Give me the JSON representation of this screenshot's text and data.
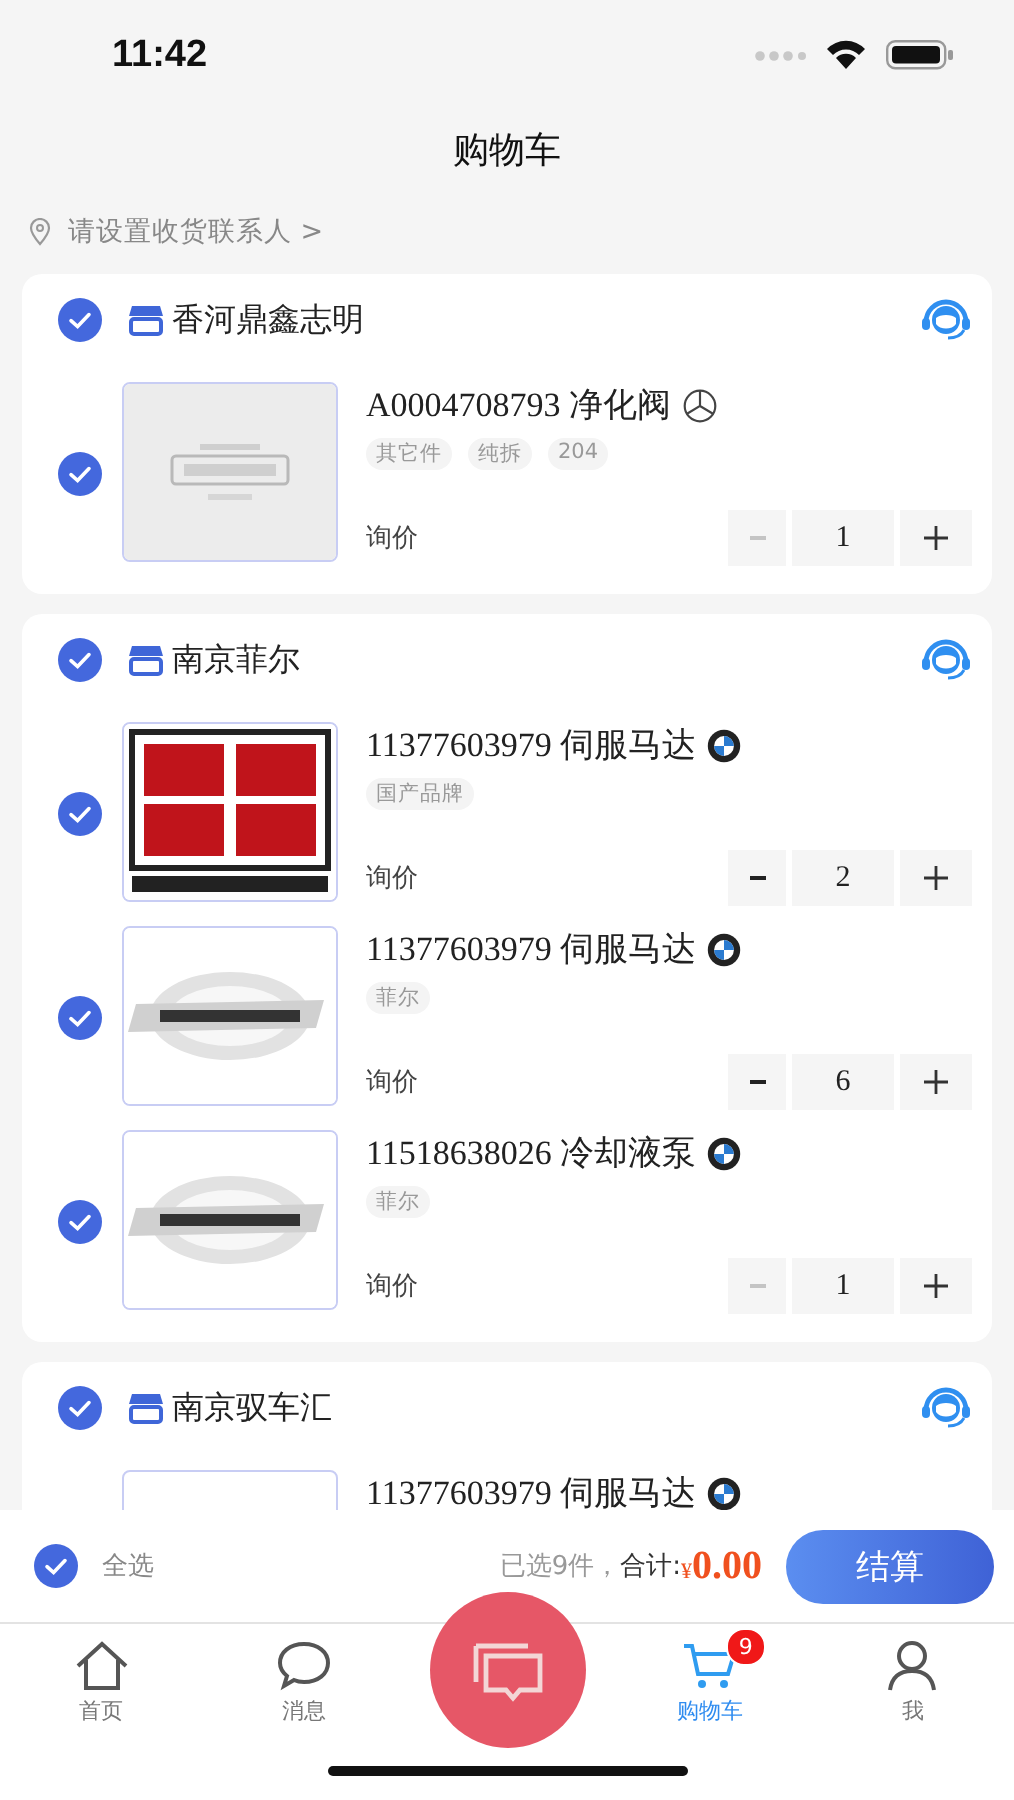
{
  "status_bar": {
    "time": "11:42"
  },
  "title": "购物车",
  "address": {
    "text": "请设置收货联系人 >"
  },
  "shops": [
    {
      "name": "香河鼎鑫志明",
      "checked": true,
      "items": [
        {
          "checked": true,
          "title": "A0004708793 净化阀",
          "tags": [
            "其它件",
            "纯拆",
            "204"
          ],
          "price": "询价",
          "quantity": "1",
          "minus_disabled": true
        }
      ]
    },
    {
      "name": "南京菲尔",
      "checked": true,
      "items": [
        {
          "checked": true,
          "title": "11377603979 伺服马达",
          "tags": [
            "国产品牌"
          ],
          "price": "询价",
          "quantity": "2",
          "minus_disabled": false
        },
        {
          "checked": true,
          "title": "11377603979 伺服马达",
          "tags": [
            "菲尔"
          ],
          "price": "询价",
          "quantity": "6",
          "minus_disabled": false
        },
        {
          "checked": true,
          "title": "11518638026 冷却液泵",
          "tags": [
            "菲尔"
          ],
          "price": "询价",
          "quantity": "1",
          "minus_disabled": true
        }
      ]
    },
    {
      "name": "南京驭车汇",
      "checked": true,
      "items": [
        {
          "title": "11377603979 伺服马达"
        }
      ]
    }
  ],
  "footer": {
    "select_all": {
      "label": "全选",
      "checked": true
    },
    "summary": "已选9件，",
    "total_label": "合计:",
    "currency": "¥",
    "total": "0.00",
    "checkout": "结算"
  },
  "tabs": [
    {
      "kind": "home",
      "label": "首页",
      "selected": false
    },
    {
      "kind": "message",
      "label": "消息",
      "selected": false
    },
    {
      "kind": "fab"
    },
    {
      "kind": "cart",
      "label": "购物车",
      "selected": true,
      "badge": "9"
    },
    {
      "kind": "profile",
      "label": "我",
      "selected": false
    }
  ]
}
